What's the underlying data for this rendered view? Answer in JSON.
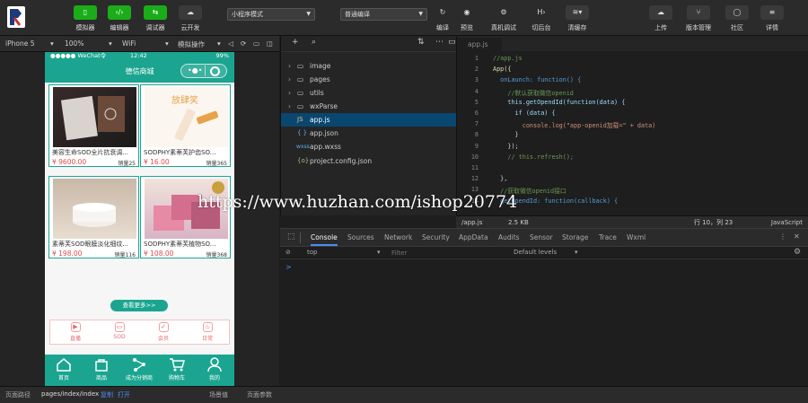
{
  "toolbar": {
    "buttons": [
      {
        "icon": "phone-icon",
        "label": "模拟器"
      },
      {
        "icon": "code-icon",
        "label": "编辑器"
      },
      {
        "icon": "debug-icon",
        "label": "调试器"
      },
      {
        "icon": "cloud-icon",
        "label": "云开发"
      }
    ],
    "mode_select": "小程序模式",
    "compile_select": "普通编译",
    "actions": [
      {
        "icon": "refresh-icon",
        "label": "编译"
      },
      {
        "icon": "eye-icon",
        "label": "预览"
      },
      {
        "icon": "device-debug-icon",
        "label": "真机调试"
      },
      {
        "icon": "switch-bg-icon",
        "label": "切后台"
      },
      {
        "icon": "clear-cache-icon",
        "label": "清缓存"
      }
    ],
    "right": [
      {
        "icon": "upload-icon",
        "label": "上传"
      },
      {
        "icon": "version-icon",
        "label": "版本管理"
      },
      {
        "icon": "community-icon",
        "label": "社区"
      },
      {
        "icon": "details-icon",
        "label": "详情"
      }
    ]
  },
  "devbar": {
    "device": "iPhone 5",
    "zoom": "100%",
    "network": "WiFi",
    "operate": "模拟操作"
  },
  "phone": {
    "status_left": "●●●●● WeChat令",
    "status_time": "12:42",
    "status_right": "99%",
    "title": "德信商城",
    "products": [
      {
        "name": "美容生命SOD全片抗衰调...",
        "price": "¥ 9600.00",
        "sold": "销量25"
      },
      {
        "name": "SODPHY素蒂芙护齿SO...",
        "price": "¥ 16.00",
        "sold": "销量365"
      },
      {
        "name": "素蒂芙SOD眼膜淡化细纹...",
        "price": "¥ 198.00",
        "sold": "销量116"
      },
      {
        "name": "SODPHY素蒂芙植物SO...",
        "price": "¥ 108.00",
        "sold": "销量368"
      }
    ],
    "card2_text": "放肆笑",
    "more_label": "查看更多>>",
    "categories": [
      "直播",
      "SOD",
      "会员",
      "日常"
    ],
    "tabs": [
      "首页",
      "商品",
      "成为分销商",
      "购物车",
      "我的"
    ]
  },
  "filetree": {
    "items": [
      {
        "type": "folder",
        "name": "image"
      },
      {
        "type": "folder",
        "name": "pages"
      },
      {
        "type": "folder",
        "name": "utils"
      },
      {
        "type": "folder",
        "name": "wxParse"
      },
      {
        "type": "js",
        "name": "app.js"
      },
      {
        "type": "json",
        "name": "app.json"
      },
      {
        "type": "wxss",
        "name": "app.wxss"
      },
      {
        "type": "json",
        "name": "project.config.json"
      }
    ],
    "selected": "app.js"
  },
  "editor": {
    "tab": "app.js",
    "lines": [
      {
        "n": "1",
        "t": "//app.js"
      },
      {
        "n": "2",
        "t": "App({"
      },
      {
        "n": "3",
        "t": "  onLaunch: function() {"
      },
      {
        "n": "4",
        "t": "    //默认获取微信openid"
      },
      {
        "n": "5",
        "t": "    this.getOpendId(function(data) {"
      },
      {
        "n": "6",
        "t": "      if (data) {"
      },
      {
        "n": "7",
        "t": "        console.log(\"app-openid加载=\" + data)"
      },
      {
        "n": "8",
        "t": "      }"
      },
      {
        "n": "9",
        "t": "    });"
      },
      {
        "n": "10",
        "t": "    // this.refresh();"
      },
      {
        "n": "11",
        "t": ""
      },
      {
        "n": "12",
        "t": "  },"
      },
      {
        "n": "13",
        "t": "  //获取微信openid接口"
      },
      {
        "n": "14",
        "t": "  getOpendId: function(callback) {"
      }
    ],
    "status": {
      "path": "/app.js",
      "size": "2.5 KB",
      "pos": "行 10，列 23",
      "lang": "JavaScript"
    }
  },
  "devtools": {
    "tabs": [
      "Console",
      "Sources",
      "Network",
      "Security",
      "AppData",
      "Audits",
      "Sensor",
      "Storage",
      "Trace",
      "Wxml"
    ],
    "active": "Console",
    "context": "top",
    "filter_placeholder": "Filter",
    "levels": "Default levels",
    "prompt": ">"
  },
  "bottom": {
    "label": "页面路径",
    "path": "pages/index/index",
    "copy": "复制",
    "open": "打开",
    "scene": "场景值",
    "params": "页面参数"
  },
  "watermark": "https://www.huzhan.com/ishop20774"
}
